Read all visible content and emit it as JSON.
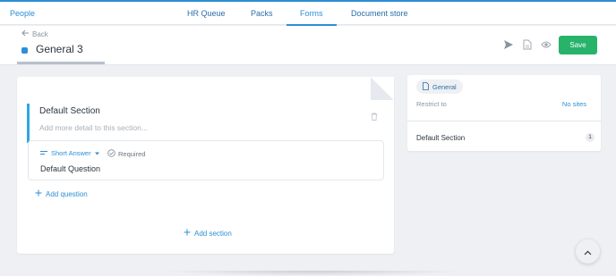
{
  "nav": {
    "home_label": "People",
    "tabs": [
      {
        "label": "HR Queue"
      },
      {
        "label": "Packs"
      },
      {
        "label": "Forms"
      },
      {
        "label": "Document store"
      }
    ]
  },
  "header": {
    "back_label": "Back",
    "title": "General 3",
    "save_label": "Save",
    "icons": [
      "send-icon",
      "document-icon",
      "eye-icon"
    ]
  },
  "form": {
    "section": {
      "title": "Default Section",
      "description_placeholder": "Add more detail to this section..."
    },
    "question": {
      "type_label": "Short Answer",
      "required_label": "Required",
      "title": "Default Question"
    },
    "add_question_label": "Add question",
    "add_section_label": "Add section"
  },
  "sidebar": {
    "badge_label": "General",
    "restrict_label": "Restrict to",
    "sites_value": "No sites",
    "section_label": "Default Section",
    "section_count": "1"
  },
  "colors": {
    "accent": "#2d8fd5",
    "save": "#27b36a",
    "section_bar": "#2ea8e0"
  }
}
